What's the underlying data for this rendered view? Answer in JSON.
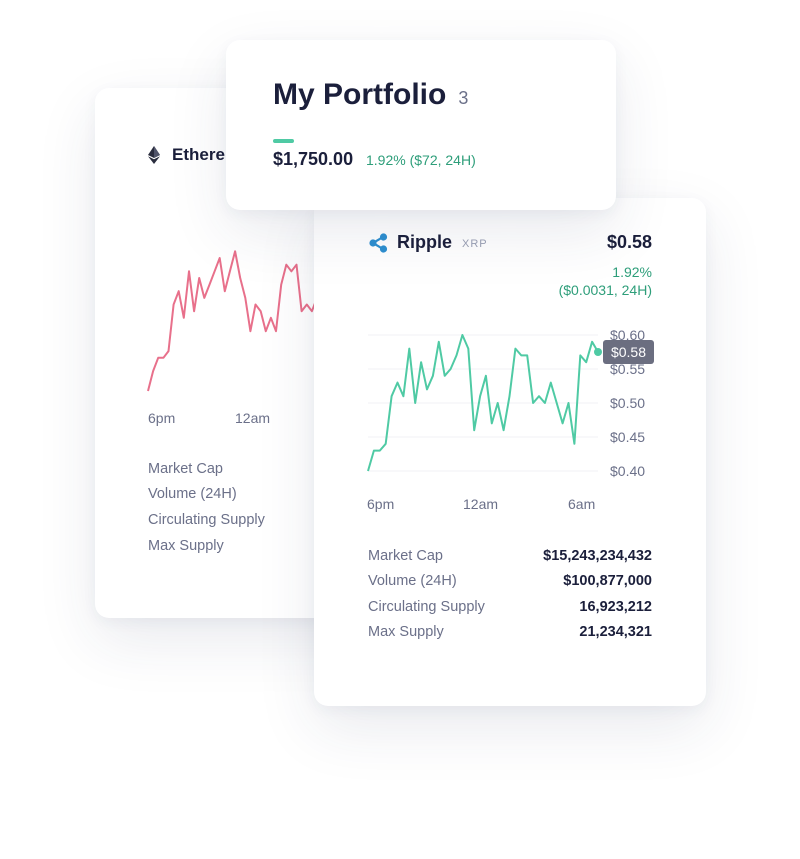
{
  "colors": {
    "eth_line": "#e8708b",
    "xrp_line": "#4fcaa4",
    "positive": "#2e9e7a",
    "ripple_brand": "#2d8fd0",
    "price_tag_bg": "#6b6e80"
  },
  "portfolio": {
    "title": "My Portfolio",
    "count": "3",
    "value": "$1,750.00",
    "change": "1.92% ($72, 24H)"
  },
  "ethereum": {
    "name": "Ethere",
    "icon": "ethereum-icon",
    "x_labels": [
      "6pm",
      "12am"
    ],
    "stats": {
      "labels": [
        "Market Cap",
        "Volume (24H)",
        "Circulating Supply",
        "Max Supply"
      ]
    },
    "chart_data": {
      "type": "line",
      "x_labels": [
        "6pm",
        "12am"
      ],
      "series": [
        {
          "values": [
            0.4,
            0.43,
            0.45,
            0.45,
            0.46,
            0.53,
            0.55,
            0.51,
            0.58,
            0.52,
            0.57,
            0.54,
            0.56,
            0.58,
            0.6,
            0.55,
            0.58,
            0.61,
            0.57,
            0.54,
            0.49,
            0.53,
            0.52,
            0.49,
            0.51,
            0.49,
            0.56,
            0.59,
            0.58,
            0.59,
            0.52,
            0.53,
            0.52,
            0.54
          ]
        }
      ]
    }
  },
  "ripple": {
    "name": "Ripple",
    "ticker": "XRP",
    "icon": "ripple-icon",
    "price": "$0.58",
    "change_pct": "1.92%",
    "change_abs": "($0.0031, 24H)",
    "current_tag": "$0.58",
    "y_labels": [
      "$0.60",
      "$0.55",
      "$0.50",
      "$0.45",
      "$0.40"
    ],
    "x_labels": [
      "6pm",
      "12am",
      "6am"
    ],
    "stats": [
      {
        "label": "Market Cap",
        "value": "$15,243,234,432"
      },
      {
        "label": "Volume (24H)",
        "value": "$100,877,000"
      },
      {
        "label": "Circulating Supply",
        "value": "16,923,212"
      },
      {
        "label": "Max Supply",
        "value": "21,234,321"
      }
    ],
    "chart_data": {
      "type": "line",
      "x_labels": [
        "6pm",
        "12am",
        "6am"
      ],
      "y_ticks": [
        0.4,
        0.45,
        0.5,
        0.55,
        0.6
      ],
      "ylim": [
        0.4,
        0.6
      ],
      "grid": true,
      "series": [
        {
          "values": [
            0.4,
            0.43,
            0.43,
            0.44,
            0.51,
            0.53,
            0.51,
            0.58,
            0.5,
            0.56,
            0.52,
            0.54,
            0.59,
            0.54,
            0.55,
            0.57,
            0.6,
            0.58,
            0.46,
            0.51,
            0.54,
            0.47,
            0.5,
            0.46,
            0.51,
            0.58,
            0.57,
            0.57,
            0.5,
            0.51,
            0.5,
            0.53,
            0.5,
            0.47,
            0.5,
            0.44,
            0.57,
            0.56,
            0.59,
            0.575
          ]
        }
      ]
    }
  }
}
